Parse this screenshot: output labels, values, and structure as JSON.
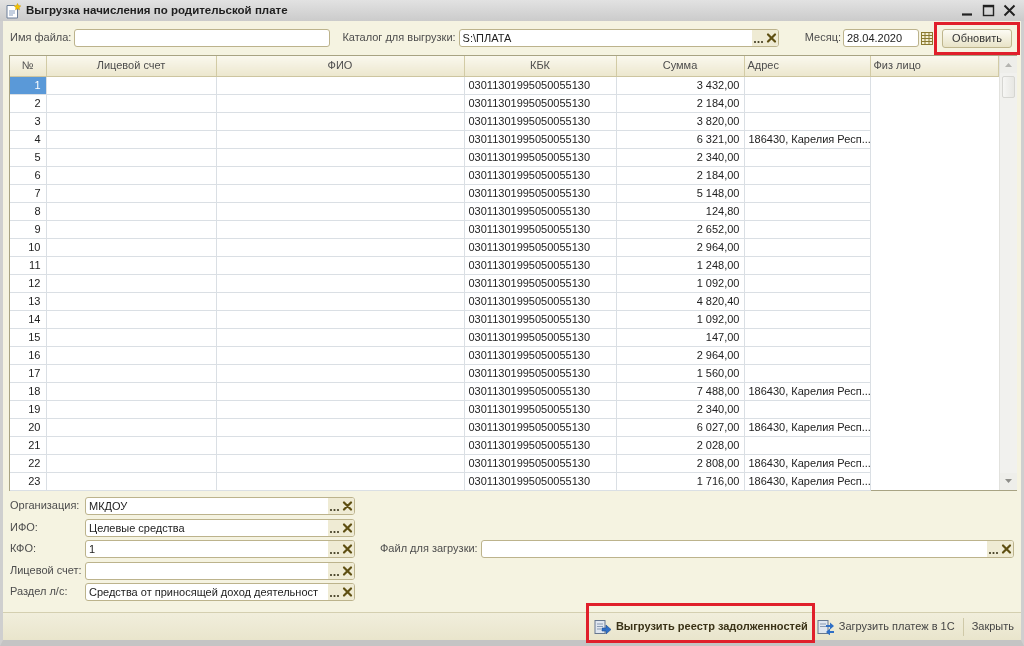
{
  "window": {
    "title": "Выгрузка начисления по родительской плате"
  },
  "toolbar": {
    "file_name": {
      "label": "Имя файла:"
    },
    "folder": {
      "label": "Каталог для выгрузки:",
      "value": "S:\\ПЛАТА"
    },
    "month": {
      "label": "Месяц:",
      "value": "28.04.2020"
    },
    "refresh": {
      "label": "Обновить",
      "highlighted": true
    }
  },
  "table": {
    "columns": [
      "№",
      "Лицевой счет",
      "ФИО",
      "КБК",
      "Сумма",
      "Адрес",
      "Физ лицо"
    ],
    "rows": [
      {
        "number": "1",
        "kbk": "03011301995050055130",
        "sum": "3 432,00",
        "selected": true
      },
      {
        "number": "2",
        "kbk": "03011301995050055130",
        "sum": "2 184,00",
        "selected": false
      },
      {
        "number": "3",
        "kbk": "03011301995050055130",
        "sum": "3 820,00",
        "selected": false
      },
      {
        "number": "4",
        "kbk": "03011301995050055130",
        "sum": "6 321,00",
        "address": "186430, Карелия Респ...",
        "selected": false
      },
      {
        "number": "5",
        "kbk": "03011301995050055130",
        "sum": "2 340,00",
        "selected": false
      },
      {
        "number": "6",
        "kbk": "03011301995050055130",
        "sum": "2 184,00",
        "selected": false
      },
      {
        "number": "7",
        "kbk": "03011301995050055130",
        "sum": "5 148,00",
        "selected": false
      },
      {
        "number": "8",
        "kbk": "03011301995050055130",
        "sum": "124,80",
        "selected": false
      },
      {
        "number": "9",
        "kbk": "03011301995050055130",
        "sum": "2 652,00",
        "selected": false
      },
      {
        "number": "10",
        "kbk": "03011301995050055130",
        "sum": "2 964,00",
        "selected": false
      },
      {
        "number": "11",
        "kbk": "03011301995050055130",
        "sum": "1 248,00",
        "selected": false
      },
      {
        "number": "12",
        "kbk": "03011301995050055130",
        "sum": "1 092,00",
        "selected": false
      },
      {
        "number": "13",
        "kbk": "03011301995050055130",
        "sum": "4 820,40",
        "selected": false
      },
      {
        "number": "14",
        "kbk": "03011301995050055130",
        "sum": "1 092,00",
        "selected": false
      },
      {
        "number": "15",
        "kbk": "03011301995050055130",
        "sum": "147,00",
        "selected": false
      },
      {
        "number": "16",
        "kbk": "03011301995050055130",
        "sum": "2 964,00",
        "selected": false
      },
      {
        "number": "17",
        "kbk": "03011301995050055130",
        "sum": "1 560,00",
        "selected": false
      },
      {
        "number": "18",
        "kbk": "03011301995050055130",
        "sum": "7 488,00",
        "address": "186430, Карелия Респ...",
        "selected": false
      },
      {
        "number": "19",
        "kbk": "03011301995050055130",
        "sum": "2 340,00",
        "selected": false
      },
      {
        "number": "20",
        "kbk": "03011301995050055130",
        "sum": "6 027,00",
        "address": "186430, Карелия Респ...",
        "selected": false
      },
      {
        "number": "21",
        "kbk": "03011301995050055130",
        "sum": "2 028,00",
        "selected": false
      },
      {
        "number": "22",
        "kbk": "03011301995050055130",
        "sum": "2 808,00",
        "address": "186430, Карелия Респ...",
        "selected": false
      },
      {
        "number": "23",
        "kbk": "03011301995050055130",
        "sum": "1 716,00",
        "address": "186430, Карелия Респ...",
        "selected": false
      }
    ]
  },
  "filters": [
    {
      "label": "Организация:",
      "value": "МКДОУ"
    },
    {
      "label": "ИФО:",
      "value": "Целевые средства"
    },
    {
      "label": "КФО:",
      "value": "1"
    },
    {
      "label": "Лицевой счет:"
    },
    {
      "label": "Раздел л/с:",
      "value": "Средства от приносящей доход деятельност"
    }
  ],
  "upload_file": {
    "label": "Файл для загрузки:"
  },
  "commands": [
    {
      "kind": "export",
      "label": "Выгрузить реестр задолженностей",
      "default": true,
      "highlighted": true
    },
    {
      "kind": "load",
      "label": "Загрузить платеж в 1С",
      "default": false,
      "highlighted": false
    },
    {
      "kind": "close",
      "label": "Закрыть",
      "default": false,
      "highlighted": false
    }
  ]
}
